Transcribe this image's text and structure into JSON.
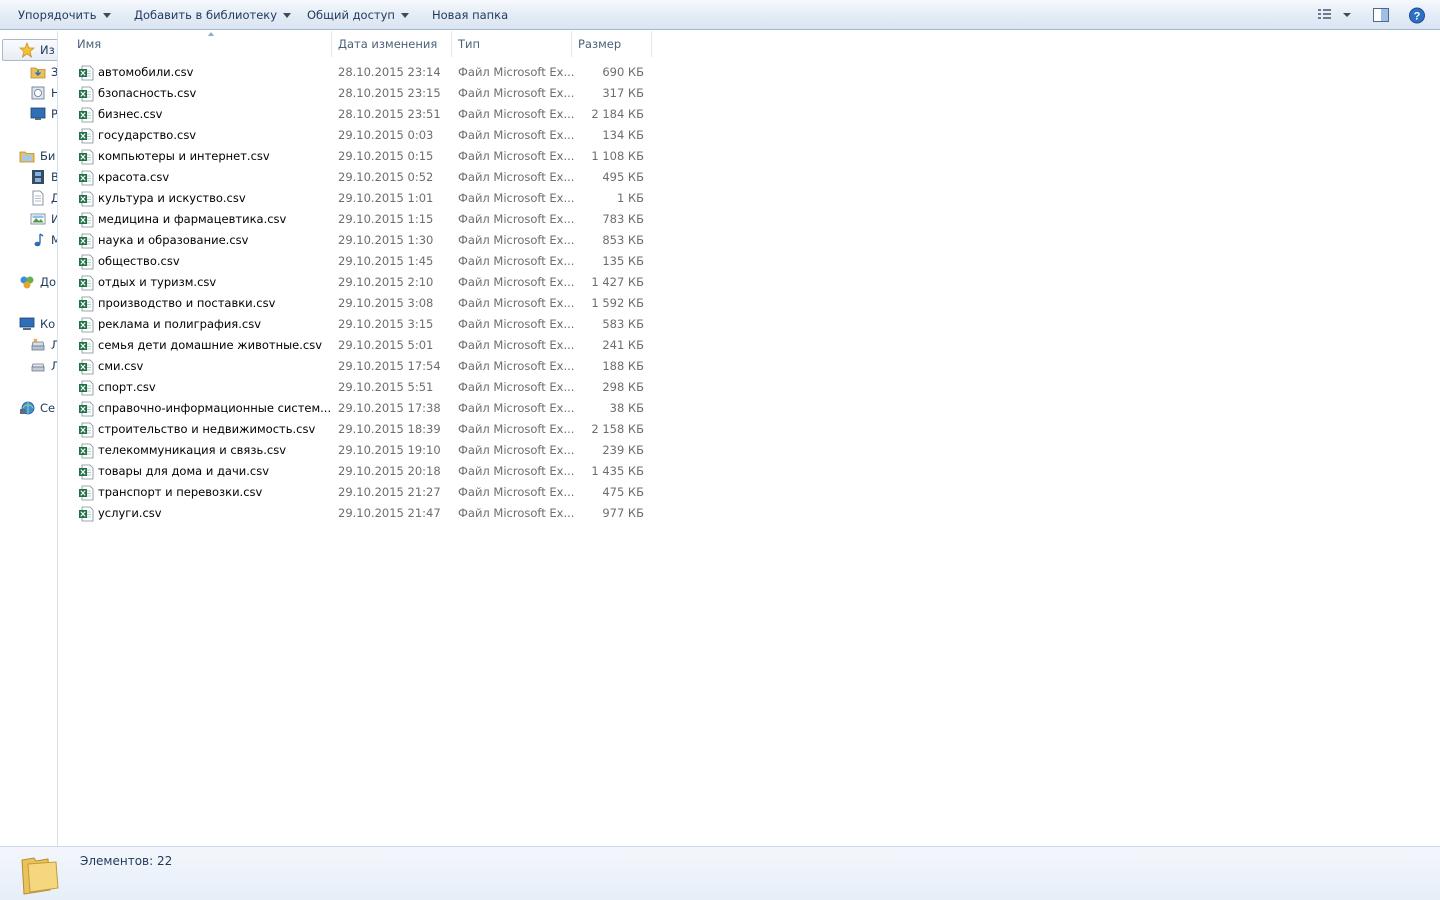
{
  "toolbar": {
    "organize": "Упорядочить",
    "add_to_library": "Добавить в библиотеку",
    "share": "Общий доступ",
    "new_folder": "Новая папка"
  },
  "nav": {
    "favorites": "Из",
    "fav_items": [
      "З",
      "Н",
      "Р"
    ],
    "libraries": "Би",
    "lib_items": [
      "В",
      "Д",
      "И",
      "М"
    ],
    "homegroup": "До",
    "computer": "Ко",
    "comp_items": [
      "Л",
      "Л"
    ],
    "network": "Се"
  },
  "columns": {
    "name": "Имя",
    "date": "Дата изменения",
    "type": "Тип",
    "size": "Размер"
  },
  "files": [
    {
      "name": "автомобили.csv",
      "date": "28.10.2015 23:14",
      "type": "Файл Microsoft Ex...",
      "size": "690 КБ"
    },
    {
      "name": "бзопасность.csv",
      "date": "28.10.2015 23:15",
      "type": "Файл Microsoft Ex...",
      "size": "317 КБ"
    },
    {
      "name": "бизнес.csv",
      "date": "28.10.2015 23:51",
      "type": "Файл Microsoft Ex...",
      "size": "2 184 КБ"
    },
    {
      "name": "государство.csv",
      "date": "29.10.2015 0:03",
      "type": "Файл Microsoft Ex...",
      "size": "134 КБ"
    },
    {
      "name": "компьютеры и интернет.csv",
      "date": "29.10.2015 0:15",
      "type": "Файл Microsoft Ex...",
      "size": "1 108 КБ"
    },
    {
      "name": "красота.csv",
      "date": "29.10.2015 0:52",
      "type": "Файл Microsoft Ex...",
      "size": "495 КБ"
    },
    {
      "name": "культура и искуство.csv",
      "date": "29.10.2015 1:01",
      "type": "Файл Microsoft Ex...",
      "size": "1 КБ"
    },
    {
      "name": "медицина и фармацевтика.csv",
      "date": "29.10.2015 1:15",
      "type": "Файл Microsoft Ex...",
      "size": "783 КБ"
    },
    {
      "name": "наука и образование.csv",
      "date": "29.10.2015 1:30",
      "type": "Файл Microsoft Ex...",
      "size": "853 КБ"
    },
    {
      "name": "общество.csv",
      "date": "29.10.2015 1:45",
      "type": "Файл Microsoft Ex...",
      "size": "135 КБ"
    },
    {
      "name": "отдых и туризм.csv",
      "date": "29.10.2015 2:10",
      "type": "Файл Microsoft Ex...",
      "size": "1 427 КБ"
    },
    {
      "name": "производство и поставки.csv",
      "date": "29.10.2015 3:08",
      "type": "Файл Microsoft Ex...",
      "size": "1 592 КБ"
    },
    {
      "name": "реклама и полиграфия.csv",
      "date": "29.10.2015 3:15",
      "type": "Файл Microsoft Ex...",
      "size": "583 КБ"
    },
    {
      "name": "семья дети домашние животные.csv",
      "date": "29.10.2015 5:01",
      "type": "Файл Microsoft Ex...",
      "size": "241 КБ"
    },
    {
      "name": "сми.csv",
      "date": "29.10.2015 17:54",
      "type": "Файл Microsoft Ex...",
      "size": "188 КБ"
    },
    {
      "name": "спорт.csv",
      "date": "29.10.2015 5:51",
      "type": "Файл Microsoft Ex...",
      "size": "298 КБ"
    },
    {
      "name": "справочно-информационные систем...",
      "date": "29.10.2015 17:38",
      "type": "Файл Microsoft Ex...",
      "size": "38 КБ"
    },
    {
      "name": "строительство и недвижимость.csv",
      "date": "29.10.2015 18:39",
      "type": "Файл Microsoft Ex...",
      "size": "2 158 КБ"
    },
    {
      "name": "телекоммуникация и связь.csv",
      "date": "29.10.2015 19:10",
      "type": "Файл Microsoft Ex...",
      "size": "239 КБ"
    },
    {
      "name": "товары для дома и дачи.csv",
      "date": "29.10.2015 20:18",
      "type": "Файл Microsoft Ex...",
      "size": "1 435 КБ"
    },
    {
      "name": "транспорт и перевозки.csv",
      "date": "29.10.2015 21:27",
      "type": "Файл Microsoft Ex...",
      "size": "475 КБ"
    },
    {
      "name": "услуги.csv",
      "date": "29.10.2015 21:47",
      "type": "Файл Microsoft Ex...",
      "size": "977 КБ"
    }
  ],
  "status": {
    "count_text": "Элементов: 22"
  },
  "icons": {
    "file": "excel-csv-icon",
    "folder": "folder-icon"
  },
  "colors": {
    "excel_green": "#1e7145",
    "toolbar_text": "#1e395b"
  }
}
